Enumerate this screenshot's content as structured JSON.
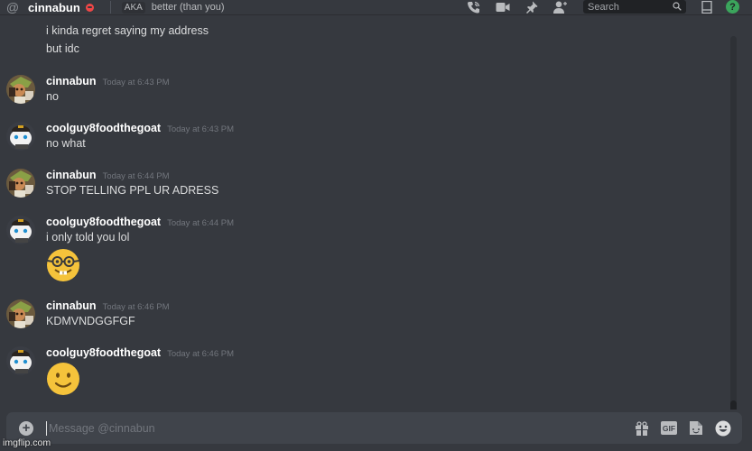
{
  "header": {
    "dm_name": "cinnabun",
    "status": "do-not-disturb",
    "aka_label": "AKA",
    "aka_value": "better (than you)",
    "search_placeholder": "Search",
    "icons": [
      "voice-call-icon",
      "video-call-icon",
      "pinned-messages-icon",
      "add-friend-icon",
      "search-icon",
      "inbox-icon",
      "help-icon"
    ],
    "help_glyph": "?"
  },
  "colors": {
    "background": "#36393f",
    "dnd_red": "#f04747",
    "help_green": "#3ba55c",
    "username": "#ffffff",
    "timestamp": "#72767d"
  },
  "chat": {
    "continuation_lines": [
      "i kinda regret saying my address",
      "but idc"
    ],
    "messages": [
      {
        "author": "cinnabun",
        "avatar": "cinnabun-avatar",
        "timestamp": "Today at 6:43 PM",
        "text": "no"
      },
      {
        "author": "coolguy8foodthegoat",
        "avatar": "coolguy-avatar",
        "timestamp": "Today at 6:43 PM",
        "text": "no what"
      },
      {
        "author": "cinnabun",
        "avatar": "cinnabun-avatar",
        "timestamp": "Today at 6:44 PM",
        "text": "STOP TELLING PPL UR ADRESS"
      },
      {
        "author": "coolguy8foodthegoat",
        "avatar": "coolguy-avatar",
        "timestamp": "Today at 6:44 PM",
        "text": "i only told you lol",
        "emoji": "nerd-face"
      },
      {
        "author": "cinnabun",
        "avatar": "cinnabun-avatar",
        "timestamp": "Today at 6:46 PM",
        "text": "KDMVNDGGFGF"
      },
      {
        "author": "coolguy8foodthegoat",
        "avatar": "coolguy-avatar",
        "timestamp": "Today at 6:46 PM",
        "text": "",
        "emoji": "slightly-smiling-face"
      }
    ]
  },
  "composer": {
    "placeholder": "Message @cinnabun",
    "value": "",
    "attach_glyph": "+",
    "gif_label": "GIF",
    "icons": [
      "gift-icon",
      "gif-icon",
      "sticker-icon",
      "emoji-icon"
    ]
  },
  "watermark": "imgflip.com"
}
